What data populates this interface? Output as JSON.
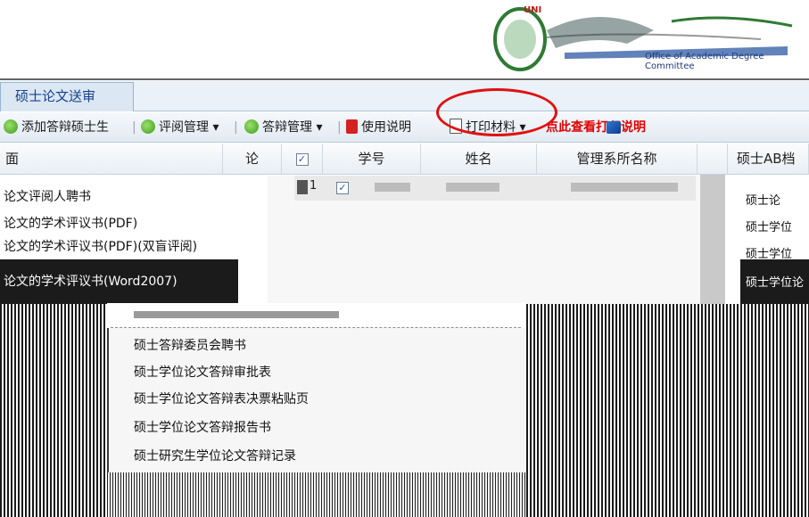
{
  "header": {
    "logo_text": "UNI",
    "logo_caption": "Office of Academic Degree Committee"
  },
  "tabs": [
    {
      "label": "硕士论文送审"
    }
  ],
  "toolbar": {
    "add_candidate": "添加答辩硕士生",
    "review_manage": "评阅管理",
    "defense_manage": "答辩管理",
    "usage_guide": "使用说明",
    "print_materials": "打印材料",
    "print_hint": "点此查看打印说明"
  },
  "grid": {
    "headers": {
      "left_fragment": "面",
      "col_fragment": "论",
      "student_id": "学号",
      "name": "姓名",
      "dept": "管理系所名称",
      "right_fragment": "硕士AB档封"
    },
    "row_number": "1",
    "row_check": "✓"
  },
  "left_menu": {
    "items": [
      "论文评阅人聘书",
      "论文的学术评议书(PDF)",
      "论文的学术评议书(PDF)(双盲评阅)",
      "论文的学术评议书(Word2007)"
    ]
  },
  "print_menu": {
    "items": [
      "硕士答辩委员会聘书",
      "硕士学位论文答辩审批表",
      "硕士学位论文答辩表决票粘贴页",
      "硕士学位论文答辩报告书",
      "硕士研究生学位论文答辩记录"
    ]
  },
  "right_column": {
    "items": [
      "硕士论",
      "硕士学位",
      "硕士学位",
      "硕士学位论"
    ]
  },
  "colors": {
    "accent": "#15428b",
    "highlight_red": "#e00000"
  }
}
